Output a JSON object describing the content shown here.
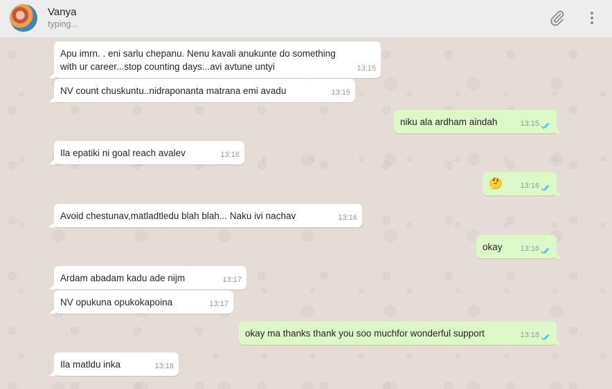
{
  "header": {
    "contact_name": "Vanya",
    "status": "typing..."
  },
  "icons": {
    "attach": "paperclip-icon",
    "menu": "more-vertical-icon",
    "read_receipt": "double-check-icon"
  },
  "colors": {
    "incoming_bubble": "#ffffff",
    "outgoing_bubble": "#dcf8c6",
    "read_ticks": "#4fc3f7"
  },
  "messages": [
    {
      "direction": "in",
      "text_line1": "Apu imrn. . eni sarlu chepanu.  Nenu kavali anukunte do something",
      "text_line2": "with ur career...stop counting days...avi avtune untyi",
      "time": "13:15"
    },
    {
      "direction": "in",
      "text": "NV count chuskuntu..nidraponanta matrana emi avadu",
      "time": "13:15"
    },
    {
      "direction": "out",
      "text": "niku ala ardham aindah",
      "time": "13:15"
    },
    {
      "direction": "in",
      "text": "Ila epatiki ni goal reach avalev",
      "time": "13:16"
    },
    {
      "direction": "out",
      "text": "🤔",
      "time": "13:16"
    },
    {
      "direction": "in",
      "text": "Avoid chestunav,matladtledu blah blah... Naku ivi nachav",
      "time": "13:16"
    },
    {
      "direction": "out",
      "text": "okay",
      "time": "13:16"
    },
    {
      "direction": "in",
      "text": "Ardam abadam kadu ade nijm",
      "time": "13:17"
    },
    {
      "direction": "in",
      "text": "NV opukuna opukokapoina",
      "time": "13:17"
    },
    {
      "direction": "out",
      "text": "okay ma thanks thank you soo muchfor wonderful support",
      "time": "13:18"
    },
    {
      "direction": "in",
      "text": "Ila matldu inka",
      "time": "13:18"
    }
  ]
}
